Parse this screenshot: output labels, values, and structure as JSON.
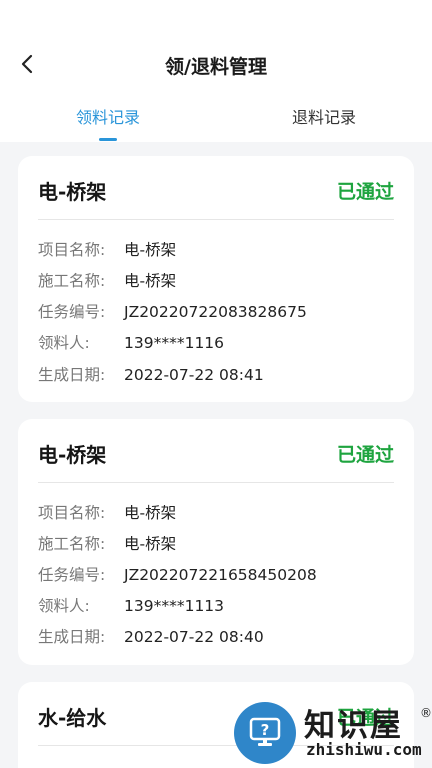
{
  "header": {
    "title": "领/退料管理",
    "tabs": [
      {
        "label": "领料记录",
        "active": true
      },
      {
        "label": "退料记录",
        "active": false
      }
    ]
  },
  "labels": {
    "project_name": "项目名称:",
    "construction_name": "施工名称:",
    "task_number": "任务编号:",
    "recipient": "领料人:",
    "created_date": "生成日期:"
  },
  "records": [
    {
      "title": "电-桥架",
      "status": "已通过",
      "project_name": "电-桥架",
      "construction_name": "电-桥架",
      "task_number": "JZ20220722083828675",
      "recipient": "139****1116",
      "created_date": "2022-07-22 08:41"
    },
    {
      "title": "电-桥架",
      "status": "已通过",
      "project_name": "电-桥架",
      "construction_name": "电-桥架",
      "task_number": "JZ202207221658450208",
      "recipient": "139****1113",
      "created_date": "2022-07-22 08:40"
    },
    {
      "title": "水-给水",
      "status": "已通过"
    }
  ],
  "watermark": {
    "brand": "知识屋",
    "registered": "®",
    "domain": "zhishiwu.com"
  },
  "colors": {
    "accent": "#2a95d9",
    "status_approved": "#1ea43f",
    "background": "#f4f5f7"
  }
}
